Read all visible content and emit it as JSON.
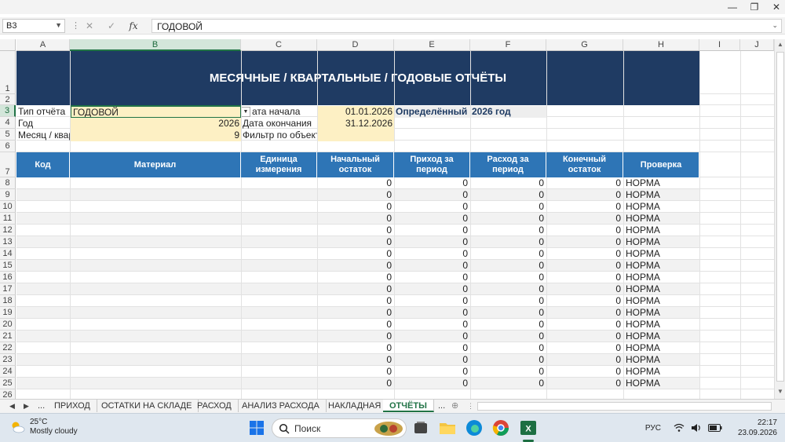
{
  "window": {
    "minimize": "—",
    "restore": "❐",
    "close": "✕"
  },
  "formula_bar": {
    "name_box": "B3",
    "value": "ГОДОВОЙ"
  },
  "columns": [
    "A",
    "B",
    "C",
    "D",
    "E",
    "F",
    "G",
    "H",
    "I",
    "J"
  ],
  "rows": [
    "1",
    "2",
    "3",
    "4",
    "5",
    "6",
    "7",
    "8",
    "9",
    "10",
    "11",
    "12",
    "13",
    "14",
    "15",
    "16",
    "17",
    "18",
    "19",
    "20",
    "21",
    "22",
    "23",
    "24",
    "25",
    "26"
  ],
  "report": {
    "title": "МЕСЯЧНЫЕ / КВАРТАЛЬНЫЕ / ГОДОВЫЕ ОТЧЁТЫ",
    "params": {
      "type_label": "Тип отчёта",
      "type_value": "ГОДОВОЙ",
      "year_label": "Год",
      "year_value": "2026",
      "month_label": "Месяц / квар",
      "month_value": "9",
      "start_label": "ата начала",
      "start_value": "01.01.2026",
      "end_label": "Дата окончания",
      "end_value": "31.12.2026",
      "filter_label": "Фильтр по объекту",
      "period_label": "Определённый п",
      "period_value": "2026 год"
    },
    "headers": [
      "Код",
      "Материал",
      "Единица измерения",
      "Начальный остаток",
      "Приход за период",
      "Расход за период",
      "Конечный остаток",
      "Проверка"
    ],
    "data_rows": [
      [
        "0",
        "0",
        "0",
        "0",
        "НОРМА"
      ],
      [
        "0",
        "0",
        "0",
        "0",
        "НОРМА"
      ],
      [
        "0",
        "0",
        "0",
        "0",
        "НОРМА"
      ],
      [
        "0",
        "0",
        "0",
        "0",
        "НОРМА"
      ],
      [
        "0",
        "0",
        "0",
        "0",
        "НОРМА"
      ],
      [
        "0",
        "0",
        "0",
        "0",
        "НОРМА"
      ],
      [
        "0",
        "0",
        "0",
        "0",
        "НОРМА"
      ],
      [
        "0",
        "0",
        "0",
        "0",
        "НОРМА"
      ],
      [
        "0",
        "0",
        "0",
        "0",
        "НОРМА"
      ],
      [
        "0",
        "0",
        "0",
        "0",
        "НОРМА"
      ],
      [
        "0",
        "0",
        "0",
        "0",
        "НОРМА"
      ],
      [
        "0",
        "0",
        "0",
        "0",
        "НОРМА"
      ],
      [
        "0",
        "0",
        "0",
        "0",
        "НОРМА"
      ],
      [
        "0",
        "0",
        "0",
        "0",
        "НОРМА"
      ],
      [
        "0",
        "0",
        "0",
        "0",
        "НОРМА"
      ],
      [
        "0",
        "0",
        "0",
        "0",
        "НОРМА"
      ],
      [
        "0",
        "0",
        "0",
        "0",
        "НОРМА"
      ],
      [
        "0",
        "0",
        "0",
        "0",
        "НОРМА"
      ]
    ]
  },
  "sheet_tabs": [
    "ПРИХОД",
    "ОСТАТКИ НА СКЛАДЕ",
    "РАСХОД",
    "АНАЛИЗ РАСХОДА",
    "НАКЛАДНАЯ",
    "ОТЧЁТЫ"
  ],
  "sheet_nav": {
    "prev": "◀",
    "next": "▶",
    "more_left": "...",
    "more_right": "...",
    "add": "⊕"
  },
  "taskbar": {
    "weather_temp": "25°C",
    "weather_desc": "Mostly cloudy",
    "search_placeholder": "Поиск",
    "lang": "РУС",
    "time": "22:17",
    "date": "23.09.2026"
  },
  "colors": {
    "title_band": "#1f3b63",
    "header_blue": "#2e75b6",
    "param_yellow": "#fdf0c4",
    "excel_green": "#217346"
  }
}
